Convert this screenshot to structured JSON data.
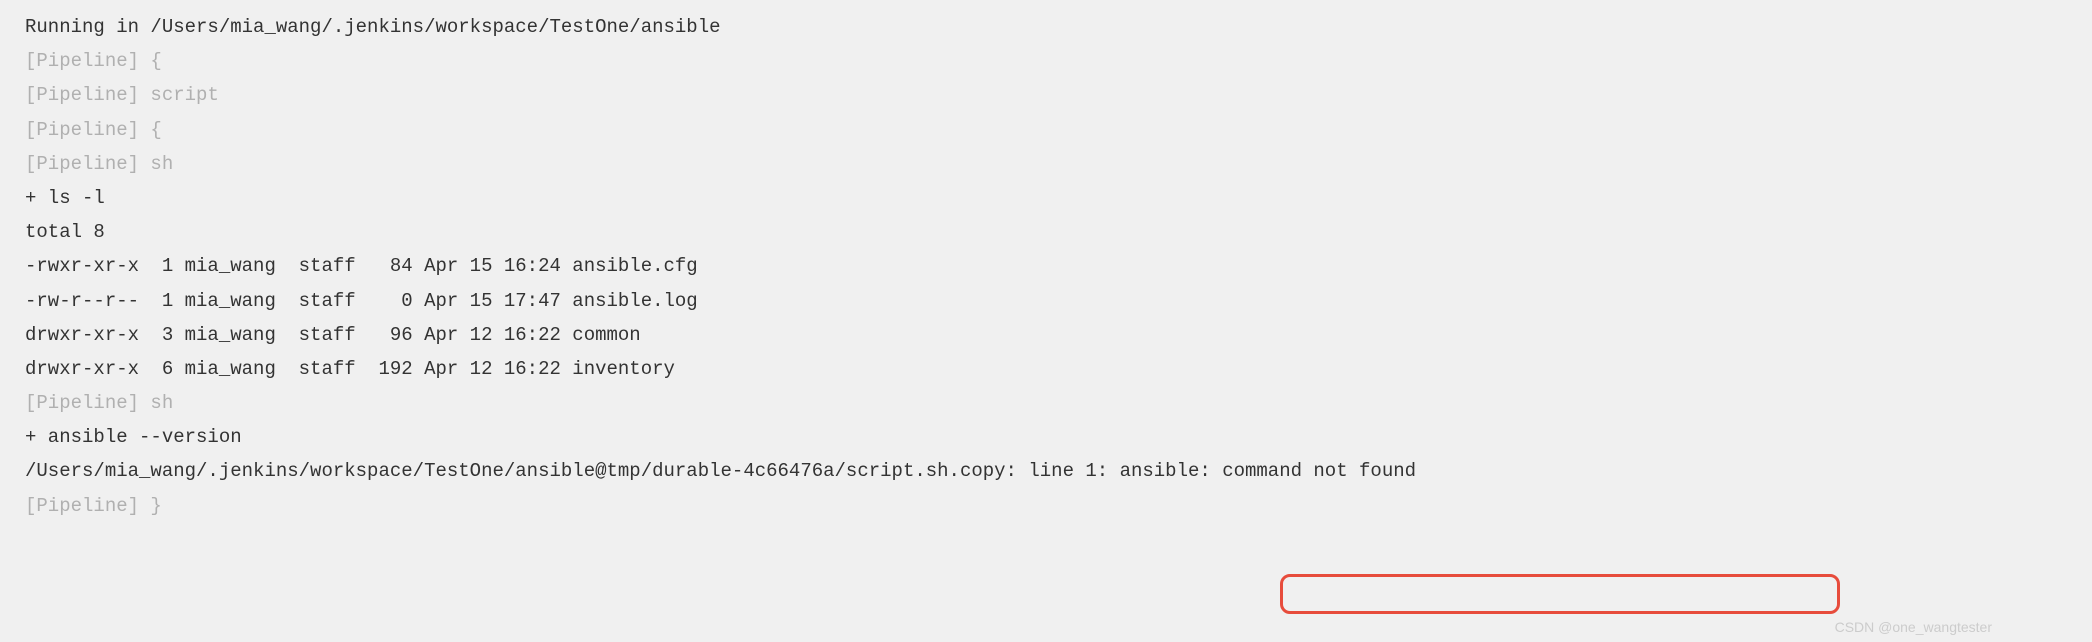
{
  "console": {
    "line1": "Running in /Users/mia_wang/.jenkins/workspace/TestOne/ansible",
    "line2_marker": "[Pipeline]",
    "line2_text": " {",
    "line3_marker": "[Pipeline]",
    "line3_text": " script",
    "line4_marker": "[Pipeline]",
    "line4_text": " {",
    "line5_marker": "[Pipeline]",
    "line5_text": " sh",
    "line6": "+ ls -l",
    "line7": "total 8",
    "line8": "-rwxr-xr-x  1 mia_wang  staff   84 Apr 15 16:24 ansible.cfg",
    "line9": "-rw-r--r--  1 mia_wang  staff    0 Apr 15 17:47 ansible.log",
    "line10": "drwxr-xr-x  3 mia_wang  staff   96 Apr 12 16:22 common",
    "line11": "drwxr-xr-x  6 mia_wang  staff  192 Apr 12 16:22 inventory",
    "line12_marker": "[Pipeline]",
    "line12_text": " sh",
    "line13": "+ ansible --version",
    "line14": "/Users/mia_wang/.jenkins/workspace/TestOne/ansible@tmp/durable-4c66476a/script.sh.copy: line 1: ansible: command not found",
    "line15_marker": "[Pipeline]",
    "line15_text": " }"
  },
  "highlight": {
    "top": "574",
    "left": "1280",
    "width": "560",
    "height": "40"
  },
  "watermark": {
    "text": "CSDN @one_wangtester",
    "bottom": "2",
    "right": "100"
  }
}
